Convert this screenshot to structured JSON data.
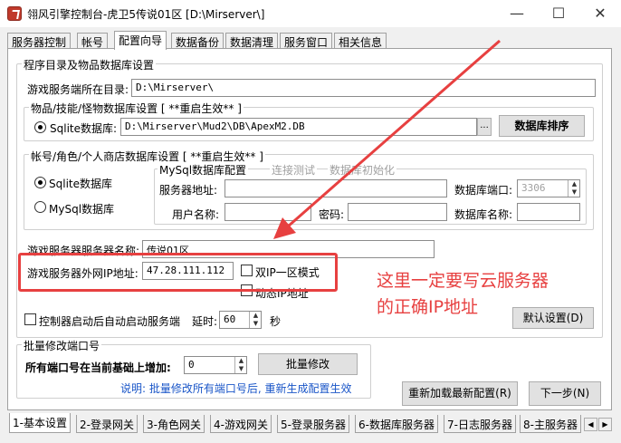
{
  "window": {
    "title": "翎风引擎控制台-虎卫5传说01区 [D:\\Mirserver\\]",
    "minimize_glyph": "—",
    "maximize_glyph": "☐",
    "close_glyph": "✕"
  },
  "top_tabs": [
    "服务器控制",
    "帐号",
    "配置向导",
    "数据备份",
    "数据清理",
    "服务窗口",
    "相关信息"
  ],
  "top_active_tab": "配置向导",
  "program_dir": {
    "group_title": "程序目录及物品数据库设置",
    "server_dir_label": "游戏服务端所在目录:",
    "server_dir_value": "D:\\Mirserver\\"
  },
  "item_db": {
    "group_title": "物品/技能/怪物数据库设置 [ **重启生效** ]",
    "sqlite_label": "Sqlite数据库:",
    "sqlite_path": "D:\\Mirserver\\Mud2\\DB\\ApexM2.DB",
    "browse_label": "...",
    "sort_button": "数据库排序"
  },
  "account_db": {
    "group_title": "帐号/角色/个人商店数据库设置 [ **重启生效** ]",
    "sqlite_option": "Sqlite数据库",
    "mysql_option": "MySql数据库",
    "mysql_group_title": "MySql数据库配置",
    "test_conn": "连接测试",
    "init_db": "数据库初始化",
    "server_addr_label": "服务器地址:",
    "server_addr_value": "",
    "db_port_label": "数据库端口:",
    "db_port_value": "3306",
    "username_label": "用户名称:",
    "username_value": "",
    "password_label": "密码:",
    "password_value": "",
    "db_name_label": "数据库名称:",
    "db_name_value": ""
  },
  "server_name": {
    "label": "游戏服务器服务器名称:",
    "value": "传说01区"
  },
  "external_ip": {
    "label": "游戏服务器外网IP地址:",
    "value": "47.28.111.112",
    "dual_ip_label": "双IP一区模式",
    "dynamic_ip_label": "动态IP地址"
  },
  "annotation": {
    "line1": "这里一定要写云服务器",
    "line2": "的正确IP地址"
  },
  "autostart": {
    "label": "控制器启动后自动启动服务端",
    "delay_label": "延时:",
    "delay_value": "60",
    "unit": "秒",
    "default_button": "默认设置(D)"
  },
  "batch_port": {
    "group_title": "批量修改端口号",
    "label": "所有端口号在当前基础上增加:",
    "value": "0",
    "button": "批量修改",
    "note": "说明: 批量修改所有端口号后, 重新生成配置生效"
  },
  "actions": {
    "reload": "重新加载最新配置(R)",
    "next": "下一步(N)"
  },
  "bottom_tabs": [
    "1-基本设置",
    "2-登录网关",
    "3-角色网关",
    "4-游戏网关",
    "5-登录服务器",
    "6-数据库服务器",
    "7-日志服务器",
    "8-主服务器"
  ],
  "bottom_active_tab": "1-基本设置",
  "colors": {
    "annotation_red": "#e74040",
    "note_blue": "#1a56c8"
  }
}
